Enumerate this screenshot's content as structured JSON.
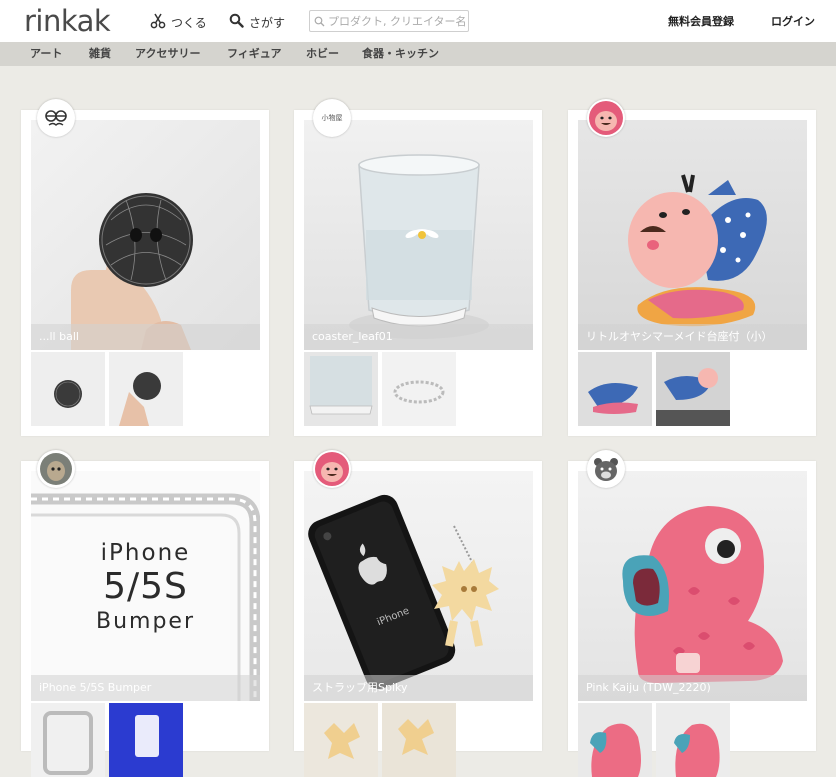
{
  "header": {
    "logo": "rinkak",
    "make_label": "つくる",
    "search_label": "さがす",
    "search_placeholder": "プロダクト, クリエイター名",
    "signup_label": "無料会員登録",
    "login_label": "ログイン"
  },
  "categories": [
    "アート",
    "雑貨",
    "アクセサリー",
    "フィギュア",
    "ホビー",
    "食器・キッチン"
  ],
  "products": [
    {
      "title": "...ll ball",
      "avatar_text": ""
    },
    {
      "title": "coaster_leaf01",
      "avatar_text": "小物屋"
    },
    {
      "title": "リトルオヤシマーメイド台座付（小）",
      "avatar_text": ""
    },
    {
      "title": "iPhone 5/5S Bumper",
      "avatar_text": ""
    },
    {
      "title": "ストラップ用Spiky",
      "avatar_text": ""
    },
    {
      "title": "Pink Kaiju (TDW_2220)",
      "avatar_text": ""
    }
  ],
  "bumper_image_text": {
    "line1": "iPhone",
    "line2": "5/5S",
    "line3": "Bumper"
  },
  "colors": {
    "header_bg": "#ffffff",
    "category_bg": "#d5d4cf",
    "page_bg": "#ecebe6",
    "text": "#333333"
  }
}
